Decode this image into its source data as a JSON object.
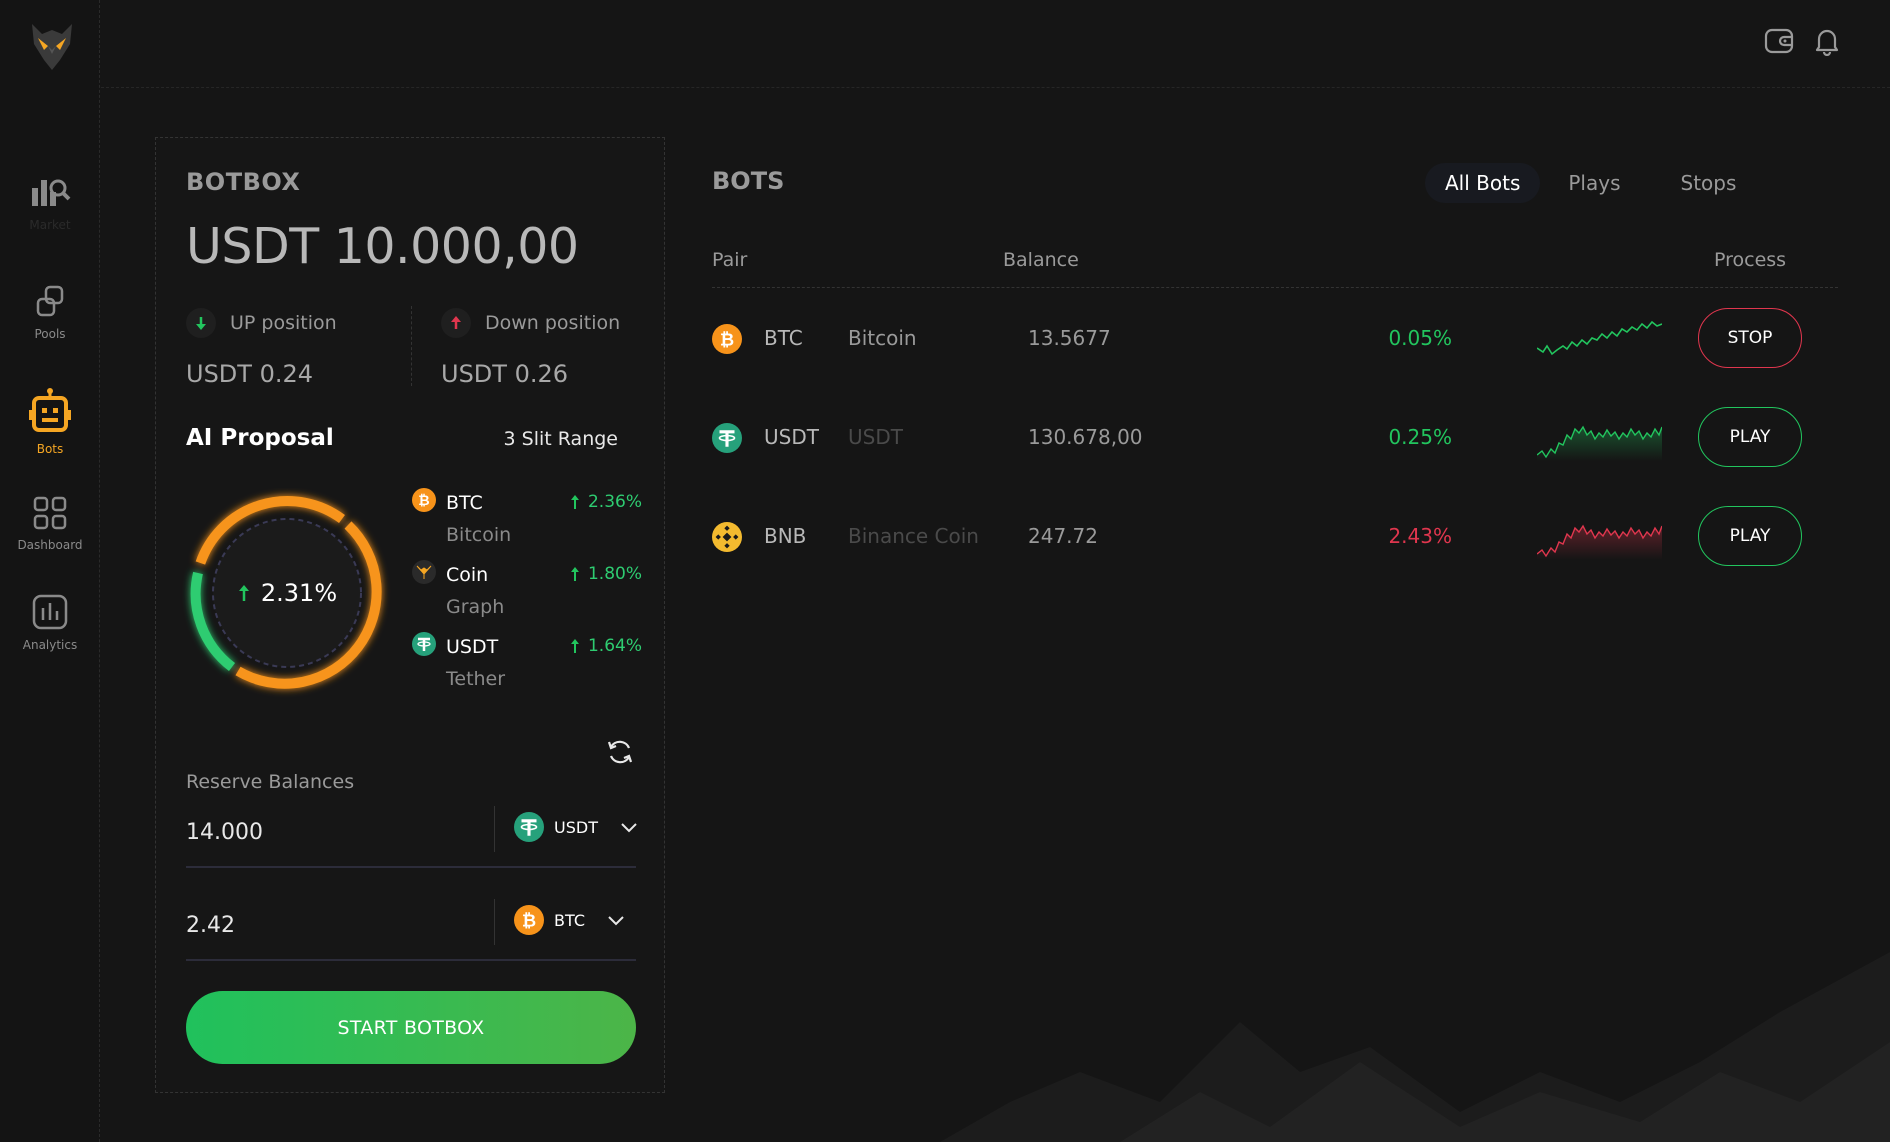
{
  "colors": {
    "accent": "#f5a623",
    "green": "#22c55e",
    "red": "#e0364e",
    "background": "#151515"
  },
  "sidebar": {
    "items": [
      {
        "icon": "chart-search-icon",
        "label": "Market"
      },
      {
        "icon": "pools-icon",
        "label": "Pools"
      },
      {
        "icon": "robot-icon",
        "label": "Bots",
        "active": true
      },
      {
        "icon": "grid-icon",
        "label": "Dashboard"
      },
      {
        "icon": "analytics-icon",
        "label": "Analytics"
      }
    ]
  },
  "topbar": {
    "icons": [
      "wallet-icon",
      "bell-icon"
    ]
  },
  "botbox": {
    "title": "BOTBOX",
    "balance": "USDT 10.000,00",
    "up_position": {
      "label": "UP position",
      "value": "USDT 0.24"
    },
    "down_position": {
      "label": "Down position",
      "value": "USDT 0.26"
    },
    "ai_proposal": {
      "title": "AI Proposal",
      "range": "3 Slit Range",
      "center_value": "2.31%",
      "coins": [
        {
          "symbol": "BTC",
          "name": "Bitcoin",
          "change": "2.36%"
        },
        {
          "symbol": "Coin",
          "name": "Graph",
          "change": "1.80%"
        },
        {
          "symbol": "USDT",
          "name": "Tether",
          "change": "1.64%"
        }
      ]
    },
    "reserve": {
      "label": "Reserve Balances",
      "fields": [
        {
          "value": "14.000",
          "currency": "USDT"
        },
        {
          "value": "2.42",
          "currency": "BTC"
        }
      ]
    },
    "start_label": "START BOTBOX"
  },
  "bots": {
    "title": "BOTS",
    "tabs": [
      "All Bots",
      "Plays",
      "Stops"
    ],
    "columns": {
      "pair": "Pair",
      "balance": "Balance",
      "process": "Process"
    },
    "rows": [
      {
        "symbol": "BTC",
        "name": "Bitcoin",
        "balance": "13.5677",
        "change": "0.05%",
        "trend": "up",
        "action": "STOP"
      },
      {
        "symbol": "USDT",
        "name": "USDT",
        "balance": "130.678,00",
        "change": "0.25%",
        "trend": "up",
        "action": "PLAY"
      },
      {
        "symbol": "BNB",
        "name": "Binance Coin",
        "balance": "247.72",
        "change": "2.43%",
        "trend": "down",
        "action": "PLAY"
      }
    ]
  }
}
